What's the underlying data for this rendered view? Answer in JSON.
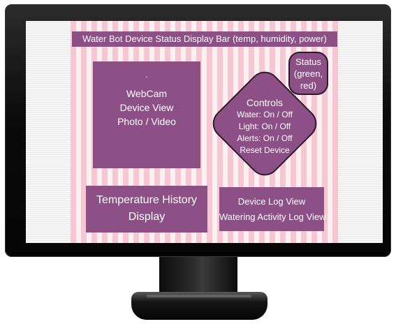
{
  "status_bar": {
    "label": "Water Bot Device Status Display Bar (temp, humidity, power)"
  },
  "webcam": {
    "dot": ".",
    "lines": [
      "WebCam",
      "Device View",
      "Photo / Video"
    ]
  },
  "status_pill": {
    "lines": [
      "Status",
      "(green,",
      "red)"
    ]
  },
  "controls": {
    "title": "Controls",
    "items": [
      "Water: On / Off",
      "Light: On / Off",
      "Alerts: On / Off",
      "Reset Device"
    ]
  },
  "temperature_history": {
    "lines": [
      "Temperature History",
      "Display"
    ]
  },
  "device_log": {
    "lines": [
      "Device Log View",
      "Watering Activity Log View"
    ]
  },
  "colors": {
    "panel_fill": "#8c4f86",
    "stripe_pink": "#f6c6d3",
    "stripe_light": "#fdf0f3",
    "screen_bg": "#f7f7f7",
    "monitor_bezel": "#0b0b0b"
  }
}
